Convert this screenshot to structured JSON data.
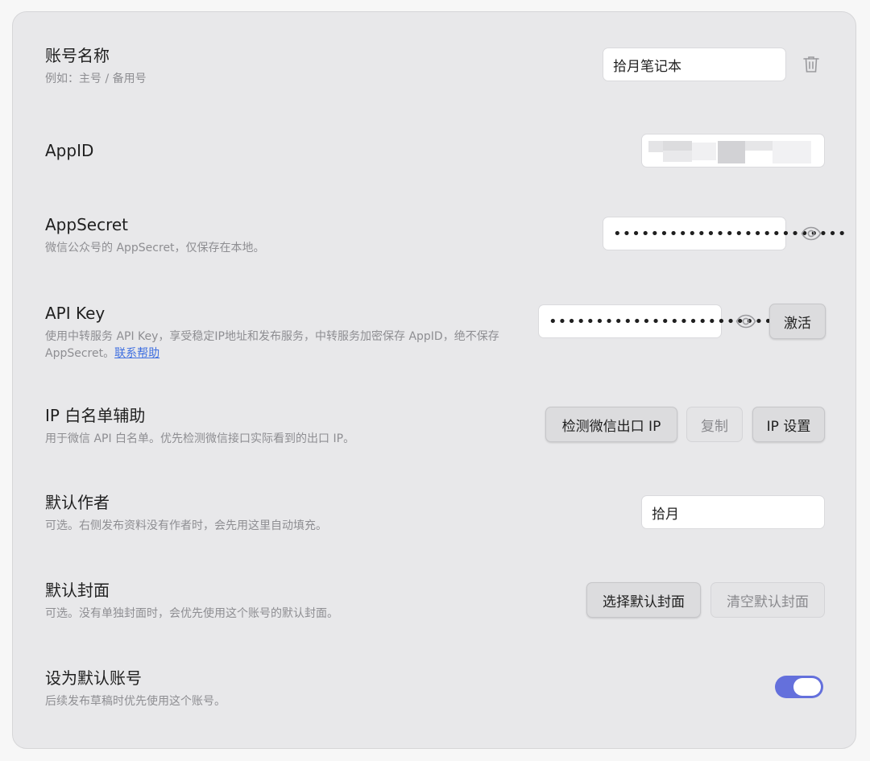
{
  "account_name": {
    "title": "账号名称",
    "desc": "例如：主号 / 备用号",
    "value": "拾月笔记本",
    "delete_icon": "trash-icon"
  },
  "appid": {
    "title": "AppID"
  },
  "appsecret": {
    "title": "AppSecret",
    "desc": "微信公众号的 AppSecret，仅保存在本地。",
    "masked_value": "•••••••••••••••••••••••••",
    "reveal_icon": "eye-icon"
  },
  "api_key": {
    "title": "API Key",
    "desc": "使用中转服务 API Key，享受稳定IP地址和发布服务，中转服务加密保存 AppID，绝不保存 AppSecret。",
    "help_link": "联系帮助",
    "masked_value": "•••••••••••••••••••••••••",
    "reveal_icon": "eye-icon",
    "activate_label": "激活"
  },
  "ip_whitelist": {
    "title": "IP 白名单辅助",
    "desc": "用于微信 API 白名单。优先检测微信接口实际看到的出口 IP。",
    "detect_label": "检测微信出口 IP",
    "copy_label": "复制",
    "settings_label": "IP 设置"
  },
  "default_author": {
    "title": "默认作者",
    "desc": "可选。右侧发布资料没有作者时，会先用这里自动填充。",
    "value": "拾月"
  },
  "default_cover": {
    "title": "默认封面",
    "desc": "可选。没有单独封面时，会优先使用这个账号的默认封面。",
    "choose_label": "选择默认封面",
    "clear_label": "清空默认封面"
  },
  "default_account": {
    "title": "设为默认账号",
    "desc": "后续发布草稿时优先使用这个账号。",
    "enabled": true,
    "toggle_color": "#6470dc"
  }
}
